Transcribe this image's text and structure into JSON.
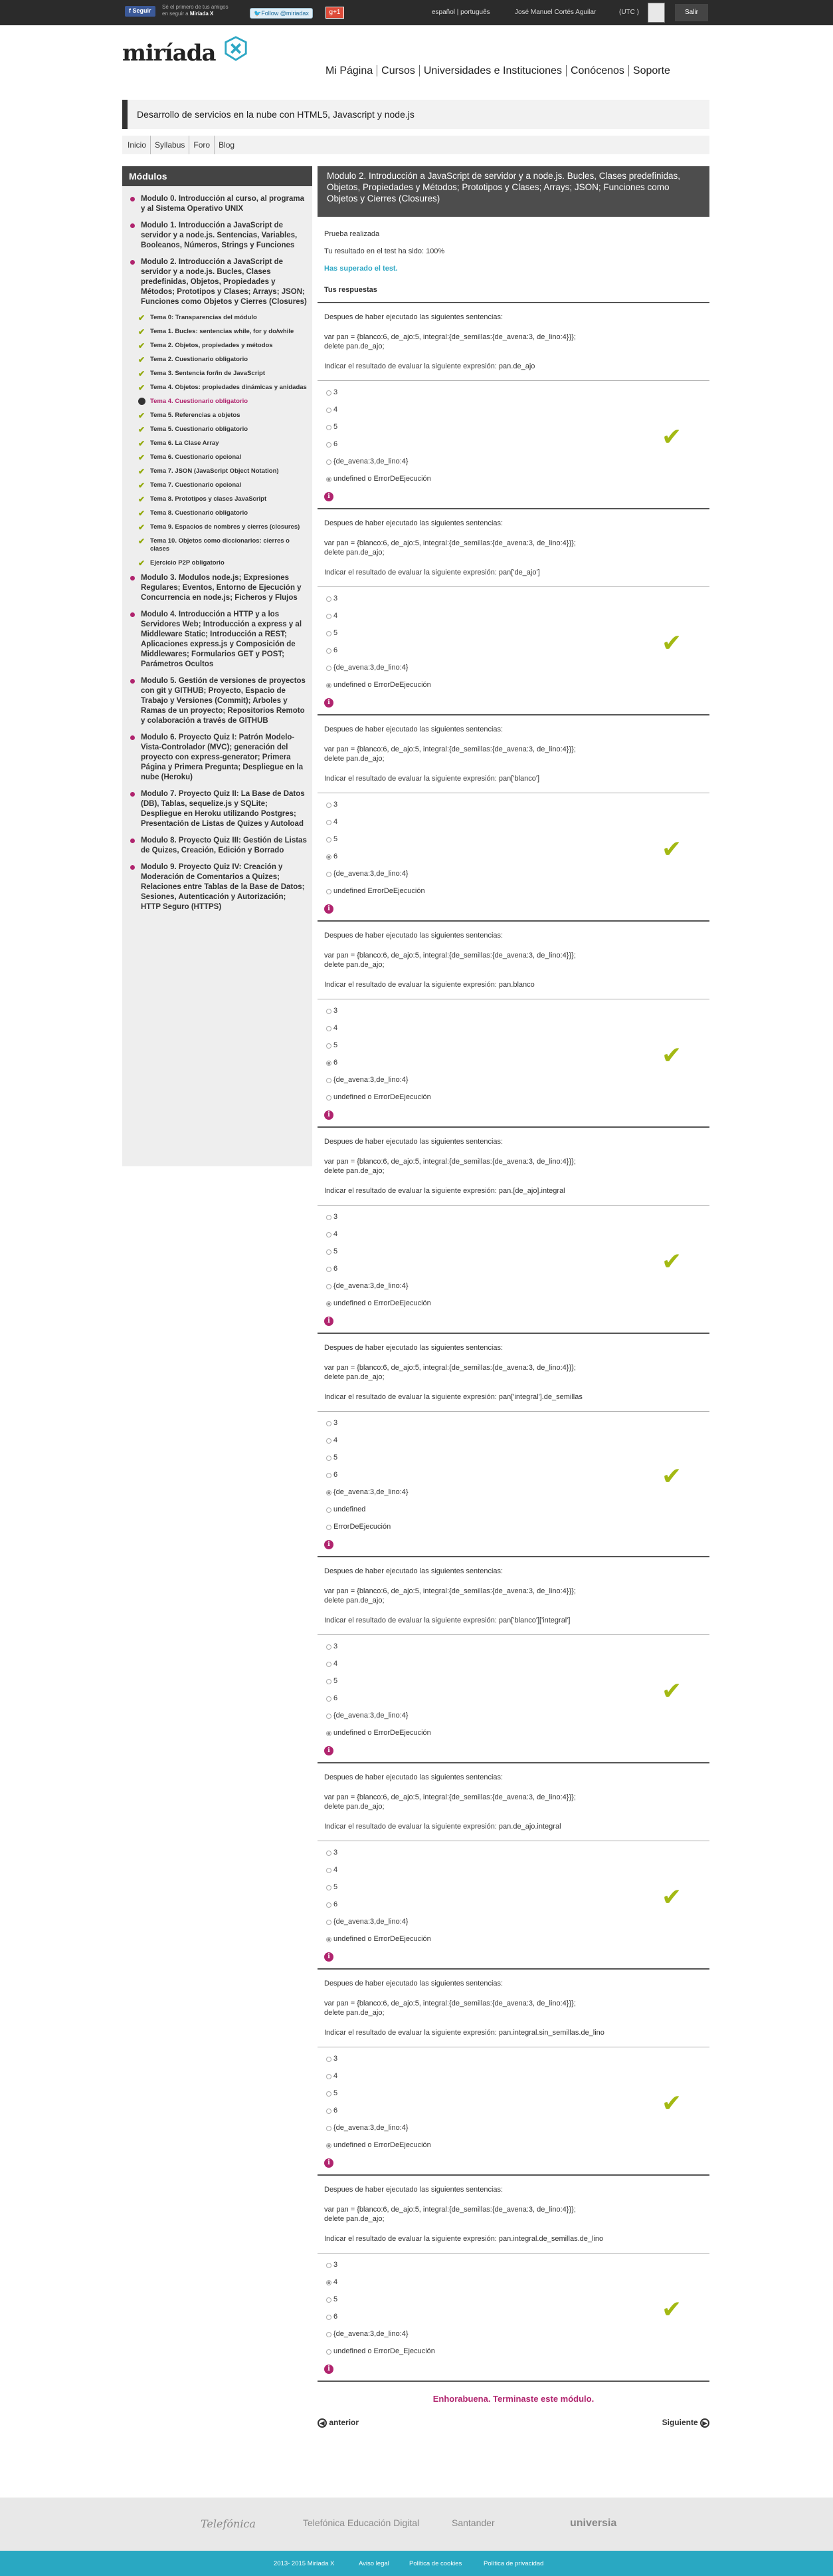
{
  "topbar": {
    "fb_button": "Seguir",
    "fb_text_a": "Sé el primero de tus amigos",
    "fb_text_b": "en seguir a",
    "fb_text_brand": "Miríada X",
    "twitter_button": "Follow @miriadax",
    "gplus_button": "g+1",
    "language": "español | português",
    "user_name": "José Manuel Cortés Aguilar",
    "utc": "(UTC )",
    "logout": "Salir"
  },
  "logo": {
    "text": "miríada"
  },
  "main_nav": [
    "Mi Página",
    "Cursos",
    "Universidades e Instituciones",
    "Conócenos",
    "Soporte"
  ],
  "course_title": "Desarrollo de servicios en la nube con HTML5, Javascript y node.js",
  "sub_nav": [
    "Inicio",
    "Syllabus",
    "Foro",
    "Blog"
  ],
  "sidebar": {
    "title": "Módulos",
    "modules_before": [
      "Modulo 0. Introducción al curso, al programa y al Sistema Operativo UNIX",
      "Modulo 1. Introducción a JavaScript de servidor y a node.js. Sentencias, Variables, Booleanos, Números, Strings y Funciones",
      "Modulo 2. Introducción a JavaScript de servidor y a node.js. Bucles, Clases predefinidas, Objetos, Propiedades y Métodos; Prototipos y Clases; Arrays; JSON; Funciones como Objetos y Cierres (Closures)"
    ],
    "temas": [
      "Tema 0: Transparencias del módulo",
      "Tema 1. Bucles: sentencias while, for y do/while",
      "Tema 2. Objetos, propiedades y métodos",
      "Tema 2. Cuestionario obligatorio",
      "Tema 3. Sentencia for/in de JavaScript",
      "Tema 4. Objetos: propiedades dinámicas y anidadas",
      "Tema 4. Cuestionario obligatorio",
      "Tema 5. Referencias a objetos",
      "Tema 5. Cuestionario obligatorio",
      "Tema 6. La Clase Array",
      "Tema 6. Cuestionario opcional",
      "Tema 7. JSON (JavaScript Object Notation)",
      "Tema 7. Cuestionario opcional",
      "Tema 8. Prototipos y clases JavaScript",
      "Tema 8. Cuestionario obligatorio",
      "Tema 9. Espacios de nombres y cierres (closures)",
      "Tema 10. Objetos como diccionarios: cierres o clases",
      "Ejercicio P2P obligatorio"
    ],
    "modules_after": [
      "Modulo 3. Modulos node.js; Expresiones Regulares; Eventos, Entorno de Ejecución y Concurrencia en node.js; Ficheros y Flujos",
      "Modulo 4. Introducción a HTTP y a los Servidores Web; Introducción a express y al Middleware Static; Introducción a REST; Aplicaciones express.js y Composición de Middlewares; Formularios GET y POST; Parámetros Ocultos",
      "Modulo 5. Gestión de versiones de proyectos con git y GITHUB; Proyecto, Espacio de Trabajo y Versiones (Commit); Arboles y Ramas de un proyecto; Repositorios Remoto y colaboración a través de GITHUB",
      "Modulo 6. Proyecto Quiz I: Patrón Modelo-Vista-Controlador (MVC); generación del proyecto con express-generator; Primera Página y Primera Pregunta; Despliegue en la nube (Heroku)",
      "Modulo 7. Proyecto Quiz II: La Base de Datos (DB), Tablas, sequelize.js y SQLite; Despliegue en Heroku utilizando Postgres; Presentación de Listas de Quizes y Autoload",
      "Modulo 8. Proyecto Quiz III: Gestión de Listas de Quizes, Creación, Edición y Borrado",
      "Modulo 9. Proyecto Quiz IV: Creación y Moderación de Comentarios a Quizes; Relaciones entre Tablas de la Base de Datos; Sesiones, Autenticación y Autorización; HTTP Seguro (HTTPS)"
    ]
  },
  "content": {
    "module_title": "Modulo 2. Introducción a JavaScript de servidor y a node.js. Bucles, Clases predefinidas, Objetos, Propiedades y Métodos; Prototipos y Clases; Arrays; JSON; Funciones como Objetos y Cierres (Closures)",
    "status": "Prueba realizada",
    "score": "Tu resultado en el test ha sido: 100%",
    "passed": "Has superado el test.",
    "answers_title": "Tus respuestas",
    "congrats": "Enhorabuena. Terminaste este módulo.",
    "prev": "anterior",
    "next": "Siguiente"
  },
  "questions": [
    {
      "intro": "Despues de haber ejecutado las siguientes sentencias:",
      "code": "var pan = {blanco:6, de_ajo:5, integral:{de_semillas:{de_avena:3, de_lino:4}}};",
      "code2": "delete pan.de_ajo;",
      "prompt": "Indicar el resultado de evaluar la siguiente expresión: pan.de_ajo",
      "options": [
        "3",
        "4",
        "5",
        "6",
        "{de_avena:3,de_lino:4}",
        "undefined o ErrorDeEjecución"
      ],
      "selected": 5
    },
    {
      "intro": "Despues de haber ejecutado las siguientes sentencias:",
      "code": "var pan = {blanco:6, de_ajo:5, integral:{de_semillas:{de_avena:3, de_lino:4}}};",
      "code2": "delete pan.de_ajo;",
      "prompt": "Indicar el resultado de evaluar la siguiente expresión: pan['de_ajo']",
      "options": [
        "3",
        "4",
        "5",
        "6",
        "{de_avena:3,de_lino:4}",
        "undefined o ErrorDeEjecución"
      ],
      "selected": 5
    },
    {
      "intro": "Despues de haber ejecutado las siguientes sentencias:",
      "code": "var pan = {blanco:6, de_ajo:5, integral:{de_semillas:{de_avena:3, de_lino:4}}};",
      "code2": "delete pan.de_ajo;",
      "prompt": "Indicar el resultado de evaluar la siguiente expresión: pan['blanco']",
      "options": [
        "3",
        "4",
        "5",
        "6",
        "{de_avena:3,de_lino:4}",
        "undefined ErrorDeEjecución"
      ],
      "selected": 3
    },
    {
      "intro": "Despues de haber ejecutado las siguientes sentencias:",
      "code": "var pan = {blanco:6, de_ajo:5, integral:{de_semillas:{de_avena:3, de_lino:4}}};",
      "code2": "delete pan.de_ajo;",
      "prompt": "Indicar el resultado de evaluar la siguiente expresión: pan.blanco",
      "options": [
        "3",
        "4",
        "5",
        "6",
        "{de_avena:3,de_lino:4}",
        "undefined o ErrorDeEjecución"
      ],
      "selected": 3
    },
    {
      "intro": "Despues de haber ejecutado las siguientes sentencias:",
      "code": "var pan = {blanco:6, de_ajo:5, integral:{de_semillas:{de_avena:3, de_lino:4}}};",
      "code2": "delete pan.de_ajo;",
      "prompt": "Indicar el resultado de evaluar la siguiente expresión: pan.[de_ajo].integral",
      "options": [
        "3",
        "4",
        "5",
        "6",
        "{de_avena:3,de_lino:4}",
        "undefined o ErrorDeEjecución"
      ],
      "selected": 5
    },
    {
      "intro": "Despues de haber ejecutado las siguientes sentencias:",
      "code": "var pan = {blanco:6, de_ajo:5, integral:{de_semillas:{de_avena:3, de_lino:4}}};",
      "code2": "delete pan.de_ajo;",
      "prompt": "Indicar el resultado de evaluar la siguiente expresión: pan['integral'].de_semillas",
      "options": [
        "3",
        "4",
        "5",
        "6",
        "{de_avena:3,de_lino:4}",
        "undefined",
        "ErrorDeEjecución"
      ],
      "selected": 4
    },
    {
      "intro": "Despues de haber ejecutado las siguientes sentencias:",
      "code": "var pan = {blanco:6, de_ajo:5, integral:{de_semillas:{de_avena:3, de_lino:4}}};",
      "code2": "delete pan.de_ajo;",
      "prompt": "Indicar el resultado de evaluar la siguiente expresión: pan['blanco']['integral']",
      "options": [
        "3",
        "4",
        "5",
        "6",
        "{de_avena:3,de_lino:4}",
        "undefined o ErrorDeEjecución"
      ],
      "selected": 5
    },
    {
      "intro": "Despues de haber ejecutado las siguientes sentencias:",
      "code": "var pan = {blanco:6, de_ajo:5, integral:{de_semillas:{de_avena:3, de_lino:4}}};",
      "code2": "delete pan.de_ajo;",
      "prompt": "Indicar el resultado de evaluar la siguiente expresión: pan.de_ajo.integral",
      "options": [
        "3",
        "4",
        "5",
        "6",
        "{de_avena:3,de_lino:4}",
        "undefined o ErrorDeEjecución"
      ],
      "selected": 5
    },
    {
      "intro": "Despues de haber ejecutado las siguientes sentencias:",
      "code": "var pan = {blanco:6, de_ajo:5, integral:{de_semillas:{de_avena:3, de_lino:4}}};",
      "code2": "delete pan.de_ajo;",
      "prompt": "Indicar el resultado de evaluar la siguiente expresión: pan.integral.sin_semillas.de_lino",
      "options": [
        "3",
        "4",
        "5",
        "6",
        "{de_avena:3,de_lino:4}",
        "undefined o ErrorDeEjecución"
      ],
      "selected": 5
    },
    {
      "intro": "Despues de haber ejecutado las siguientes sentencias:",
      "code": "var pan = {blanco:6, de_ajo:5, integral:{de_semillas:{de_avena:3, de_lino:4}}};",
      "code2": "delete pan.de_ajo;",
      "prompt": "Indicar el resultado de evaluar la siguiente expresión: pan.integral.de_semillas.de_lino",
      "options": [
        "3",
        "4",
        "5",
        "6",
        "{de_avena:3,de_lino:4}",
        "undefined o ErrorDe_Ejecución"
      ],
      "selected": 1
    }
  ],
  "footer": {
    "partners": [
      "Telefónica",
      "Telefónica Educación Digital",
      "Santander",
      "universia"
    ],
    "links": [
      "2013- 2015 Miríada X",
      "Aviso legal",
      "Política de cookies",
      "Política de privacidad"
    ]
  },
  "colors": {
    "accent_magenta": "#b0246e",
    "check_green": "#a3b913",
    "link_blue": "#2ea7c4",
    "footer_blue": "#29a8c2"
  }
}
